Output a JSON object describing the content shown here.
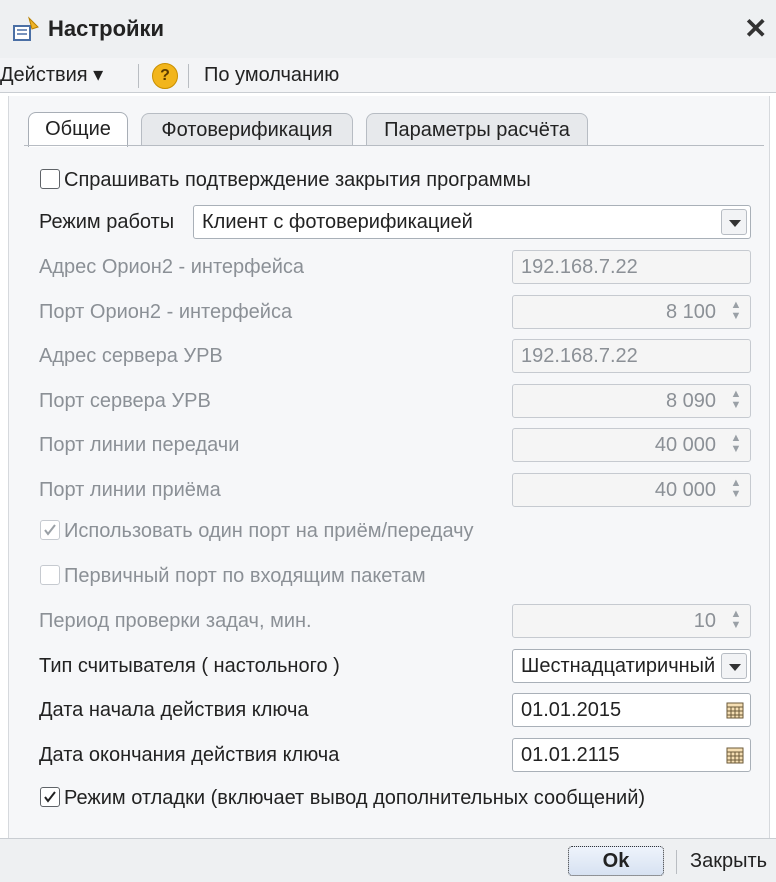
{
  "window": {
    "title": "Настройки"
  },
  "toolbar": {
    "actions_label": "Действия ▾",
    "help_label": "?",
    "defaults_label": "По умолчанию"
  },
  "tabs": [
    {
      "label": "Общие",
      "active": true
    },
    {
      "label": "Фотоверификация",
      "active": false
    },
    {
      "label": "Параметры расчёта",
      "active": false
    }
  ],
  "form": {
    "confirm_exit": {
      "label": "Спрашивать подтверждение закрытия программы",
      "checked": false
    },
    "mode": {
      "label": "Режим работы",
      "value": "Клиент с фотоверификацией"
    },
    "orion_address": {
      "label": "Адрес Орион2 - интерфейса",
      "value": "192.168.7.22"
    },
    "orion_port": {
      "label": "Порт Орион2 - интерфейса",
      "value": "8 100"
    },
    "urv_address": {
      "label": "Адрес сервера УРВ",
      "value": "192.168.7.22"
    },
    "urv_port": {
      "label": "Порт сервера УРВ",
      "value": "8 090"
    },
    "tx_port": {
      "label": "Порт линии передачи",
      "value": "40 000"
    },
    "rx_port": {
      "label": "Порт линии приёма",
      "value": "40 000"
    },
    "single_port": {
      "label": "Использовать один порт на приём/передачу",
      "checked": true
    },
    "primary_port": {
      "label": "Первичный порт по входящим пакетам",
      "checked": false
    },
    "task_period": {
      "label": "Период проверки задач, мин.",
      "value": "10"
    },
    "reader_type": {
      "label": "Тип считывателя ( настольного )",
      "value": "Шестнадцатиричный"
    },
    "key_start": {
      "label": "Дата начала действия ключа",
      "value": "01.01.2015"
    },
    "key_end": {
      "label": "Дата окончания действия ключа",
      "value": "01.01.2115"
    },
    "debug": {
      "label": "Режим отладки (включает вывод дополнительных сообщений)",
      "checked": true
    }
  },
  "footer": {
    "ok_label": "Ok",
    "close_label": "Закрыть"
  },
  "colors": {
    "title_bg": "#eef0f2",
    "panel_bg": "#f6f7f9",
    "disabled_text": "#8b9096"
  },
  "icons": [
    "settings-icon",
    "close-icon",
    "help-icon",
    "dropdown-icon",
    "spinner-icon",
    "calendar-icon",
    "checkmark-icon"
  ]
}
